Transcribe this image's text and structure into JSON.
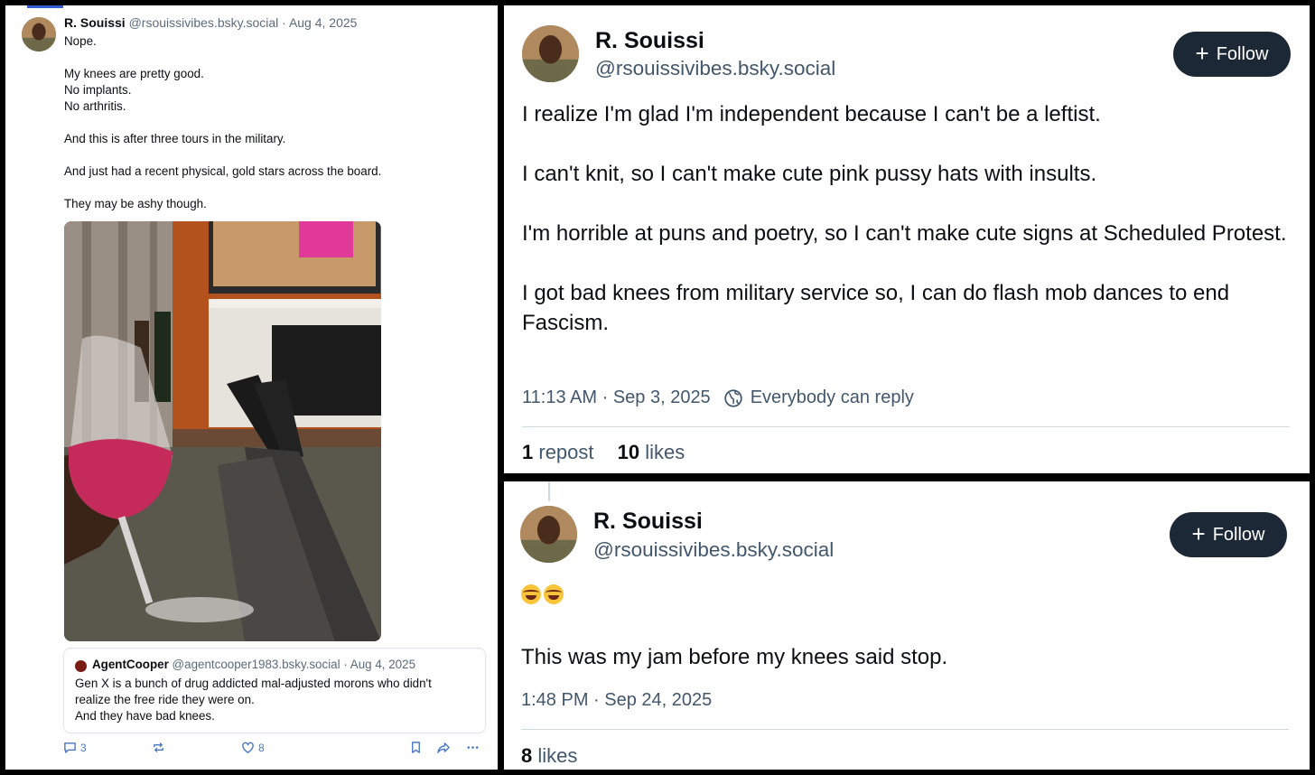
{
  "left_post": {
    "author_name": "R. Souissi",
    "author_handle": "@rsouissivibes.bsky.social",
    "date": "Aug 4, 2025",
    "text_lines": [
      "Nope.",
      "",
      "My knees are pretty good.",
      "No implants.",
      "No arthritis.",
      "",
      "And this is after three tours in the military.",
      "",
      "And just had a recent physical, gold stars across the board.",
      "",
      "They may be ashy though."
    ],
    "quote": {
      "author_name": "AgentCooper",
      "author_handle": "@agentcooper1983.bsky.social",
      "date": "Aug 4, 2025",
      "text_lines": [
        "Gen X is a bunch of drug addicted mal-adjusted morons who didn't",
        "realize the free ride they were on.",
        "And they have bad knees."
      ]
    },
    "actions": {
      "reply_count": "3",
      "like_count": "8"
    }
  },
  "top_right_post": {
    "author_name": "R. Souissi",
    "author_handle": "@rsouissivibes.bsky.social",
    "follow_label": "Follow",
    "paragraphs": [
      "I realize I'm glad I'm independent because I can't be a leftist.",
      "I can't knit, so I can't make cute pink pussy hats with insults.",
      "I'm horrible at puns and poetry, so I can't make cute signs at Scheduled Protest.",
      "I got bad knees from military service so, I can do flash mob dances to end Fascism."
    ],
    "time": "11:13 AM",
    "date": "Sep 3, 2025",
    "reply_setting": "Everybody can reply",
    "repost_count": "1",
    "repost_label": "repost",
    "like_count": "10",
    "like_label": "likes"
  },
  "bottom_right_post": {
    "author_name": "R. Souissi",
    "author_handle": "@rsouissivibes.bsky.social",
    "follow_label": "Follow",
    "emoji": "😂😂",
    "text": "This was my jam before my knees said stop.",
    "time": "1:48 PM",
    "date": "Sep 24, 2025",
    "like_count": "8",
    "like_label": "likes"
  },
  "colors": {
    "follow_button": "#1c2836",
    "handle_text": "#42576c",
    "action_icons": "#4a78c0",
    "background": "#000000"
  }
}
